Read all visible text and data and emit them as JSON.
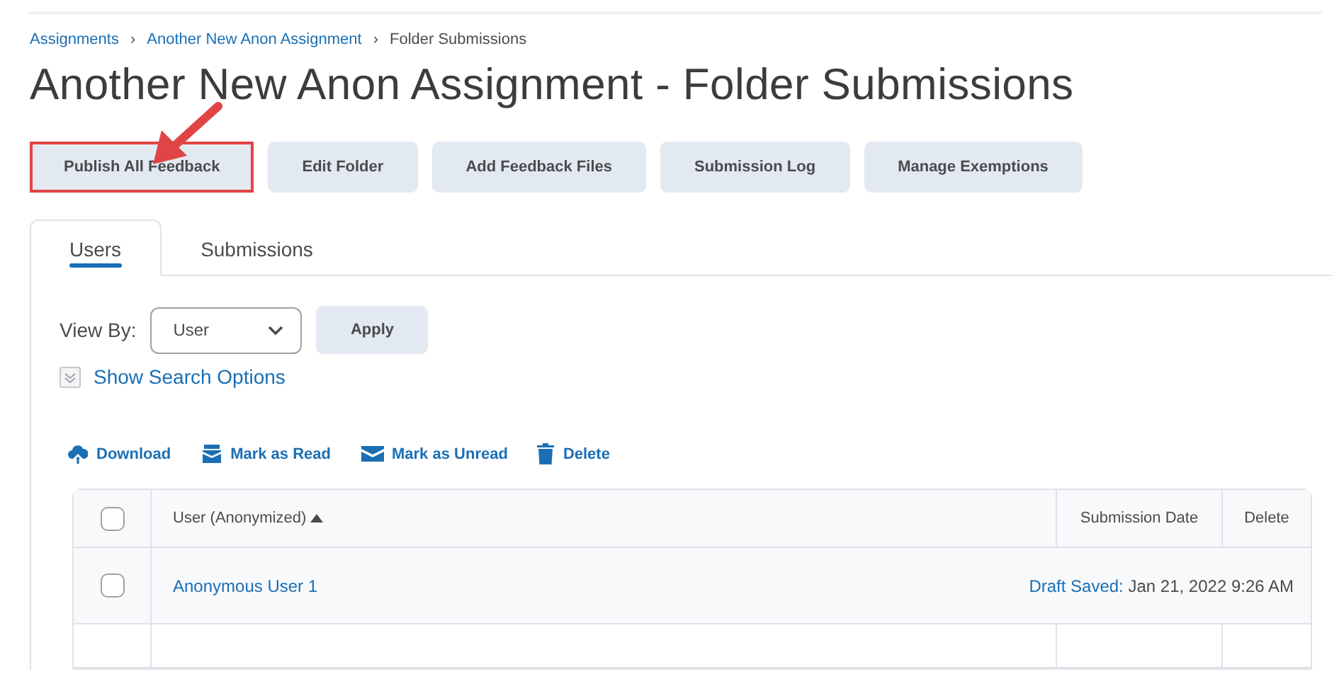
{
  "breadcrumbs": [
    {
      "label": "Assignments",
      "link": true
    },
    {
      "label": "Another New Anon Assignment",
      "link": true
    },
    {
      "label": "Folder Submissions",
      "link": false
    }
  ],
  "separator": "›",
  "title": "Another New Anon Assignment - Folder Submissions",
  "buttons": [
    {
      "label": "Publish All Feedback",
      "highlighted": true
    },
    {
      "label": "Edit Folder",
      "highlighted": false
    },
    {
      "label": "Add Feedback Files",
      "highlighted": false
    },
    {
      "label": "Submission Log",
      "highlighted": false
    },
    {
      "label": "Manage Exemptions",
      "highlighted": false
    }
  ],
  "tabs": [
    {
      "label": "Users",
      "selected": true
    },
    {
      "label": "Submissions",
      "selected": false
    }
  ],
  "view_by": {
    "label": "View By:",
    "value": "User",
    "apply": "Apply"
  },
  "search_options": {
    "label": "Show Search Options",
    "expanded": false
  },
  "actions": [
    {
      "kind": "download",
      "label": "Download"
    },
    {
      "kind": "read",
      "label": "Mark as Read"
    },
    {
      "kind": "unread",
      "label": "Mark as Unread"
    },
    {
      "kind": "delete",
      "label": "Delete"
    }
  ],
  "table": {
    "select_all": {
      "checked": false
    },
    "columns": [
      "User (Anonymized)",
      "Submission Date",
      "Delete"
    ],
    "rows": [
      {
        "checked": false,
        "user": "Anonymous User 1",
        "status": "Draft Saved:",
        "date": "Jan 21, 2022 9:26 AM"
      }
    ]
  }
}
